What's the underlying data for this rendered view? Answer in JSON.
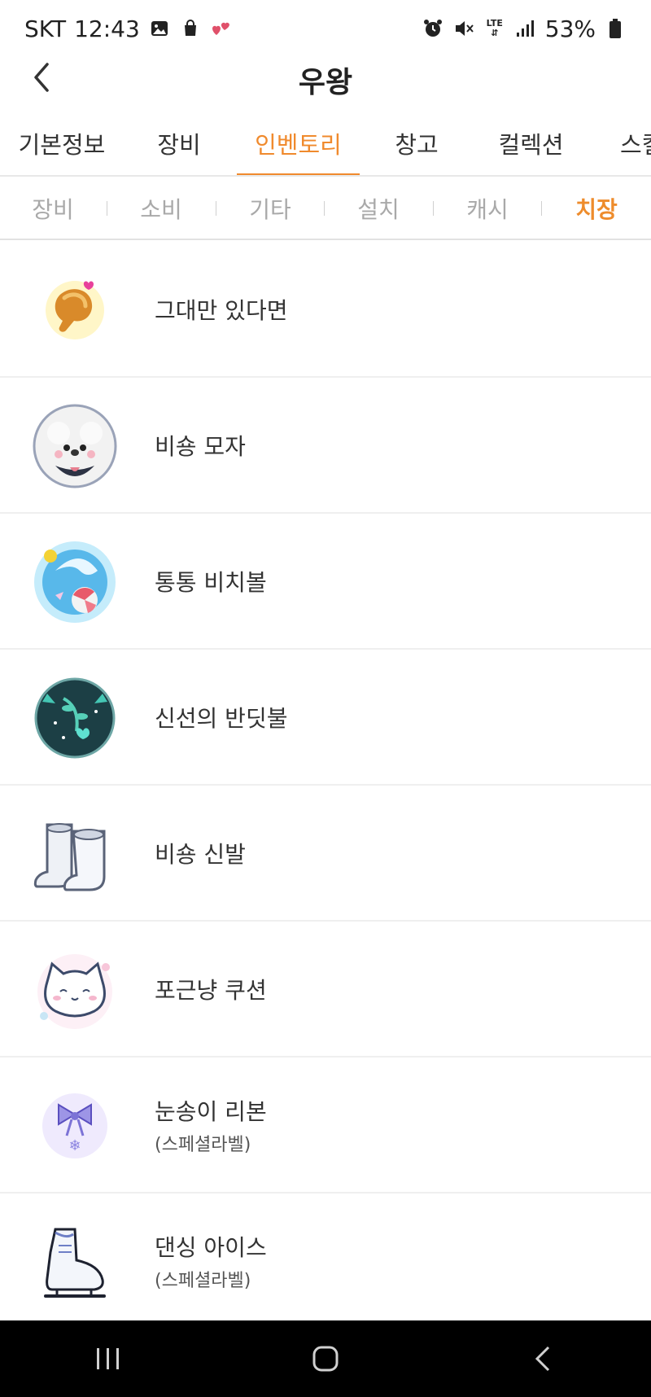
{
  "status_bar": {
    "carrier": "SKT",
    "time": "12:43",
    "battery": "53%",
    "network": "LTE",
    "icons_left": [
      "gallery-icon",
      "shopping-bag-icon",
      "hearts-icon"
    ],
    "icons_right": [
      "alarm-icon",
      "mute-icon",
      "lte-icon",
      "signal-icon",
      "battery-icon"
    ]
  },
  "header": {
    "title": "우왕"
  },
  "main_tabs": [
    {
      "label": "기본정보",
      "active": false
    },
    {
      "label": "장비",
      "active": false
    },
    {
      "label": "인벤토리",
      "active": true
    },
    {
      "label": "창고",
      "active": false
    },
    {
      "label": "컬렉션",
      "active": false
    },
    {
      "label": "스킬",
      "active": false
    }
  ],
  "sub_tabs": [
    {
      "label": "장비",
      "active": false
    },
    {
      "label": "소비",
      "active": false
    },
    {
      "label": "기타",
      "active": false
    },
    {
      "label": "설치",
      "active": false
    },
    {
      "label": "캐시",
      "active": false
    },
    {
      "label": "치장",
      "active": true
    }
  ],
  "items": [
    {
      "name": "그대만 있다면",
      "sub": "",
      "icon": "drumstick-icon"
    },
    {
      "name": "비숑 모자",
      "sub": "",
      "icon": "bichon-hat-icon"
    },
    {
      "name": "통통 비치볼",
      "sub": "",
      "icon": "beach-ball-icon"
    },
    {
      "name": "신선의 반딧불",
      "sub": "",
      "icon": "firefly-orb-icon"
    },
    {
      "name": "비숑 신발",
      "sub": "",
      "icon": "bichon-shoes-icon"
    },
    {
      "name": "포근냥 쿠션",
      "sub": "",
      "icon": "cat-cushion-icon"
    },
    {
      "name": "눈송이 리본",
      "sub": "(스페셜라벨)",
      "icon": "snowflake-ribbon-icon"
    },
    {
      "name": "댄싱 아이스",
      "sub": "(스페셜라벨)",
      "icon": "ice-skate-icon"
    }
  ],
  "colors": {
    "accent": "#f08a2d",
    "inactive_tab": "#a9a9a9",
    "navbar": "#000000"
  }
}
